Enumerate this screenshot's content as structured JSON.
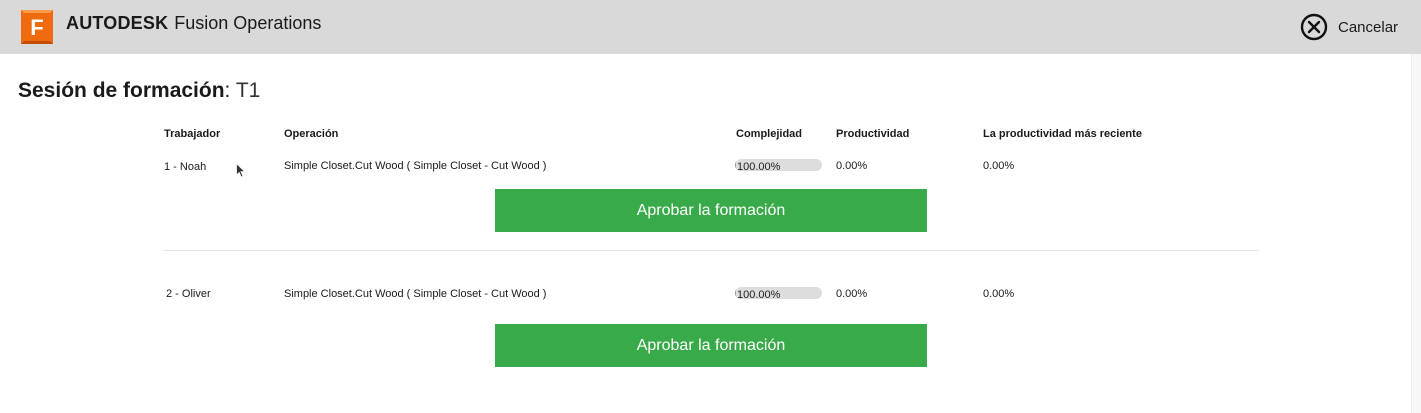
{
  "header": {
    "logo_letter": "F",
    "brand_bold": "AUTODESK",
    "brand_product": "Fusion Operations",
    "cancel_label": "Cancelar",
    "accent_color": "#f06a0f"
  },
  "page": {
    "title_label": "Sesión de formación",
    "title_sep": ": ",
    "title_value": "T1"
  },
  "table": {
    "columns": [
      "Trabajador",
      "Operación",
      "Complejidad",
      "Productividad",
      "La productividad más reciente"
    ],
    "rows": [
      {
        "worker": "1 - Noah",
        "operation": "Simple Closet.Cut Wood ( Simple Closet - Cut Wood )",
        "complexity": "100.00%",
        "complexity_fraction": 1.0,
        "productivity": "0.00%",
        "recent_productivity": "0.00%",
        "approve_label": "Aprobar la formación"
      },
      {
        "worker": "2 - Oliver",
        "operation": "Simple Closet.Cut Wood ( Simple Closet - Cut Wood )",
        "complexity": "100.00%",
        "complexity_fraction": 1.0,
        "productivity": "0.00%",
        "recent_productivity": "0.00%",
        "approve_label": "Aprobar la formación"
      }
    ]
  },
  "colors": {
    "approve_button": "#39aa4a",
    "topbar": "#d9d9d9"
  }
}
